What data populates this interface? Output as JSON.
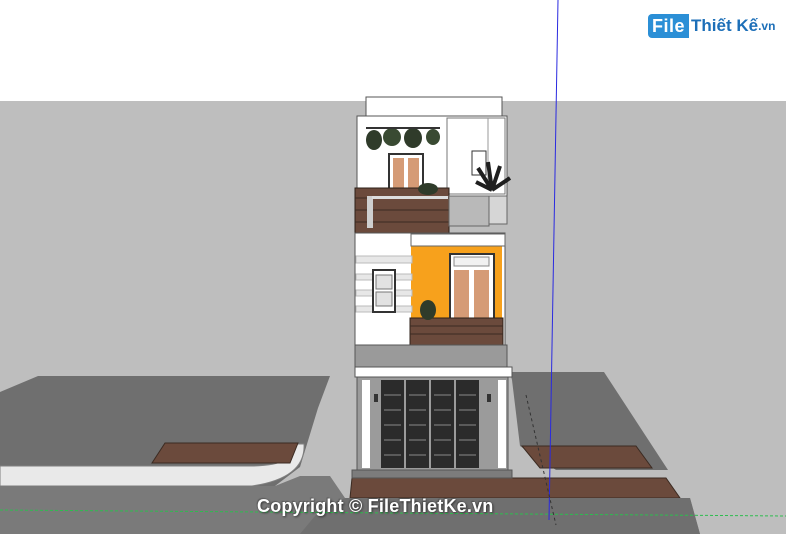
{
  "watermark": {
    "logo_file": "File",
    "logo_rest": "Thiết Kế",
    "logo_domain": ".vn",
    "copyright": "Copyright © FileThietKe.vn"
  },
  "colors": {
    "sky": "#ffffff",
    "ground": "#bdbdbd",
    "road": "#6e6e6e",
    "sidewalk": "#9c9c9c",
    "wood": "#6b4a3c",
    "orange": "#f7a11c",
    "wall": "#ffffff",
    "blue_axis": "#2a2ae0",
    "green_axis": "#2dbd4f",
    "logo_blue": "#2b8fd6"
  },
  "icons": [
    "axis-blue-vertical",
    "axis-green-horizontal",
    "plant-icon"
  ]
}
